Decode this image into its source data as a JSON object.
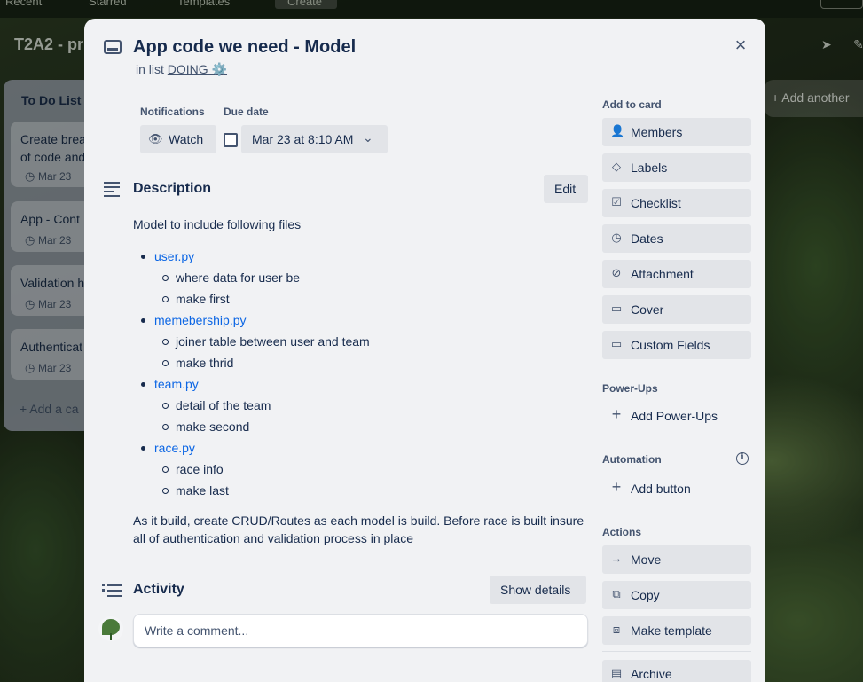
{
  "topnav": {
    "items": [
      "Recent",
      "Starred",
      "Templates",
      "Create"
    ]
  },
  "board": {
    "title": "T2A2 - pr",
    "add_list_label": "Add another",
    "list": {
      "title": "To Do List",
      "cards": [
        {
          "title_line1": "Create brea",
          "title_line2": "of code and",
          "date": "Mar 23"
        },
        {
          "title_line1": "App - Cont",
          "date": "Mar 23"
        },
        {
          "title_line1": "Validation h",
          "date": "Mar 23"
        },
        {
          "title_line1": "Authenticat",
          "date": "Mar 23"
        }
      ],
      "add_card_label": "Add a ca"
    }
  },
  "modal": {
    "title": "App code we need - Model",
    "in_list_prefix": "in list",
    "list_name": "DOING ⚙️",
    "close_icon": "×",
    "notifications_label": "Notifications",
    "watch_label": "Watch",
    "due_date_label": "Due date",
    "due_date_value": "Mar 23 at 8:10 AM",
    "description_title": "Description",
    "edit_label": "Edit",
    "description": {
      "intro": "Model to include following files",
      "files": [
        {
          "name": "user.py",
          "notes": [
            "where data for user be",
            "make first"
          ]
        },
        {
          "name": "memebership.py",
          "notes": [
            "joiner table between user and team",
            "make thrid"
          ]
        },
        {
          "name": "team.py",
          "notes": [
            "detail of the team",
            "make second"
          ]
        },
        {
          "name": "race.py",
          "notes": [
            "race info",
            "make last"
          ]
        }
      ],
      "outro": "As it build, create CRUD/Routes as each model is build. Before race is built insure all of authentication and validation process in place"
    },
    "activity_title": "Activity",
    "show_details_label": "Show details",
    "comment_placeholder": "Write a comment..."
  },
  "sidebar": {
    "add_to_card_label": "Add to card",
    "add_to_card": [
      {
        "label": "Members",
        "icon": "person-icon"
      },
      {
        "label": "Labels",
        "icon": "tag-icon"
      },
      {
        "label": "Checklist",
        "icon": "checklist-icon"
      },
      {
        "label": "Dates",
        "icon": "clock-icon"
      },
      {
        "label": "Attachment",
        "icon": "paperclip-icon"
      },
      {
        "label": "Cover",
        "icon": "cover-icon"
      },
      {
        "label": "Custom Fields",
        "icon": "custom-fields-icon"
      }
    ],
    "power_ups_label": "Power-Ups",
    "add_power_ups": "Add Power-Ups",
    "automation_label": "Automation",
    "add_button": "Add button",
    "actions_label": "Actions",
    "actions": [
      {
        "label": "Move",
        "icon": "arrow-right-icon"
      },
      {
        "label": "Copy",
        "icon": "copy-icon"
      },
      {
        "label": "Make template",
        "icon": "template-icon"
      },
      {
        "label": "Archive",
        "icon": "archive-icon"
      }
    ]
  },
  "colors": {
    "modal_bg": "#f1f2f4",
    "button_bg": "#e2e4e8",
    "link": "#0c66e4",
    "text": "#172b4d",
    "subtle_text": "#44546f"
  }
}
